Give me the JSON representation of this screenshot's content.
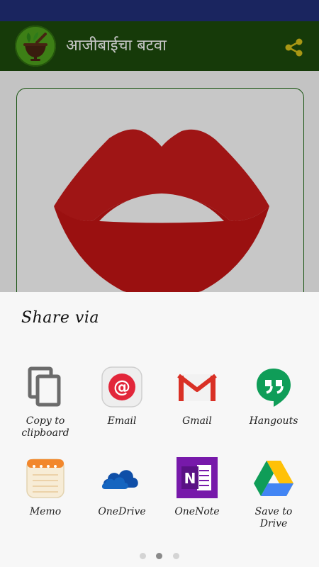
{
  "app_bar": {
    "title": "आजीबाईचा बटवा",
    "logo_icon": "mortar-pestle-herb-icon",
    "share_icon": "share-icon",
    "color": "#1d4b0c"
  },
  "content": {
    "image_icon": "red-lips-image"
  },
  "share_sheet": {
    "title": "Share via",
    "items": [
      {
        "label_line1": "Copy to",
        "label_line2": "clipboard",
        "icon": "copy-icon"
      },
      {
        "label_line1": "Email",
        "label_line2": "",
        "icon": "email-icon"
      },
      {
        "label_line1": "Gmail",
        "label_line2": "",
        "icon": "gmail-icon"
      },
      {
        "label_line1": "Hangouts",
        "label_line2": "",
        "icon": "hangouts-icon"
      },
      {
        "label_line1": "Memo",
        "label_line2": "",
        "icon": "memo-icon"
      },
      {
        "label_line1": "OneDrive",
        "label_line2": "",
        "icon": "onedrive-icon"
      },
      {
        "label_line1": "OneNote",
        "label_line2": "",
        "icon": "onenote-icon"
      },
      {
        "label_line1": "Save to",
        "label_line2": "Drive",
        "icon": "google-drive-icon"
      }
    ],
    "page_count": 3,
    "active_page": 2
  }
}
